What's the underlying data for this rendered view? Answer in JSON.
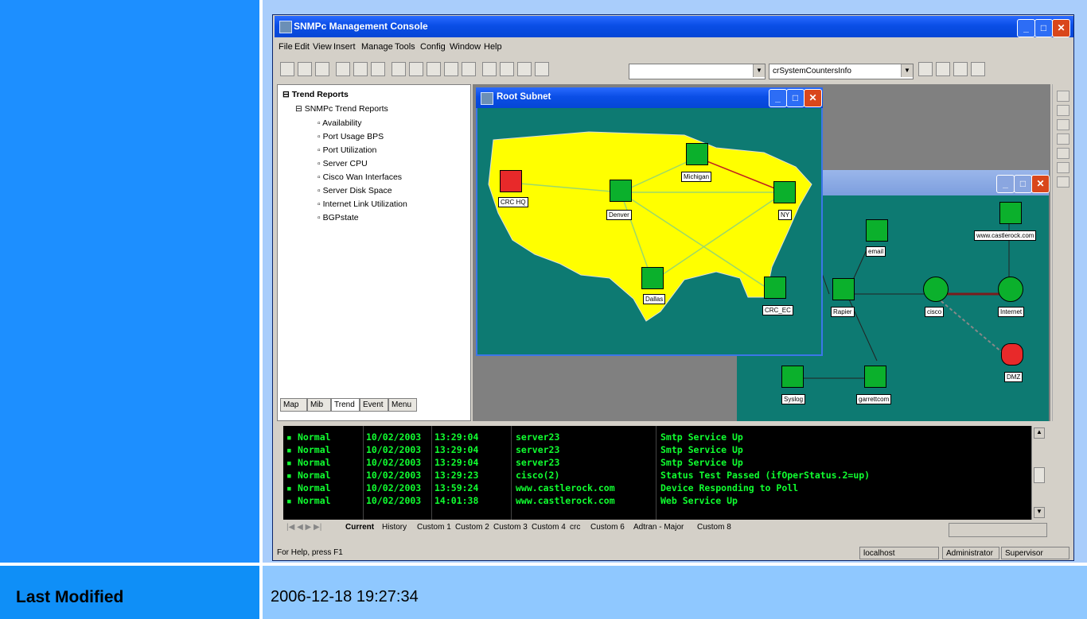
{
  "app": {
    "title": "SNMPc Management Console",
    "menu": [
      "File",
      "Edit",
      "View",
      "Insert",
      "Manage",
      "Tools",
      "Config",
      "Window",
      "Help"
    ],
    "combo1_value": "",
    "combo2_value": "crSystemCountersInfo"
  },
  "tree": {
    "root": "Trend Reports",
    "group": "SNMPc Trend Reports",
    "items": [
      "Availability",
      "Port Usage BPS",
      "Port Utilization",
      "Server CPU",
      "Cisco Wan Interfaces",
      "Server Disk Space",
      "Internet Link Utilization",
      "BGPstate"
    ],
    "tabs": [
      "Map",
      "Mib",
      "Trend",
      "Event",
      "Menu"
    ]
  },
  "root_subnet": {
    "title": "Root Subnet",
    "nodes": [
      "CRC HQ",
      "Denver",
      "Michigan",
      "NY",
      "Dallas",
      "CRC_EC"
    ]
  },
  "network_window": {
    "nodes": [
      "email",
      "www.castlerock.com",
      "Rapier",
      "cisco",
      "Internet",
      "DMZ",
      "Syslog",
      "garrettcom"
    ]
  },
  "event_log": {
    "rows": [
      {
        "status": "Normal",
        "date": "10/02/2003",
        "time": "13:29:04",
        "source": "server23",
        "message": "Smtp Service Up"
      },
      {
        "status": "Normal",
        "date": "10/02/2003",
        "time": "13:29:04",
        "source": "server23",
        "message": "Smtp Service Up"
      },
      {
        "status": "Normal",
        "date": "10/02/2003",
        "time": "13:29:04",
        "source": "server23",
        "message": "Smtp Service Up"
      },
      {
        "status": "Normal",
        "date": "10/02/2003",
        "time": "13:29:23",
        "source": "cisco(2)",
        "message": "Status Test Passed (ifOperStatus.2=up)"
      },
      {
        "status": "Normal",
        "date": "10/02/2003",
        "time": "13:59:24",
        "source": "www.castlerock.com",
        "message": "Device Responding to Poll"
      },
      {
        "status": "Normal",
        "date": "10/02/2003",
        "time": "14:01:38",
        "source": "www.castlerock.com",
        "message": "Web Service Up"
      }
    ],
    "tabs": [
      "Current",
      "History",
      "Custom 1",
      "Custom 2",
      "Custom 3",
      "Custom 4",
      "crc",
      "Custom 6",
      "Adtran - Major",
      "Custom 8"
    ]
  },
  "status_bar": {
    "help": "For Help, press F1",
    "host": "localhost",
    "user": "Administrator",
    "role": "Supervisor"
  },
  "table": {
    "label": "Last Modified",
    "value": "2006-12-18 19:27:34"
  },
  "colors": {
    "map_land": "#ffff00",
    "map_bg": "#0d7a72",
    "log_text": "#10ff30"
  }
}
